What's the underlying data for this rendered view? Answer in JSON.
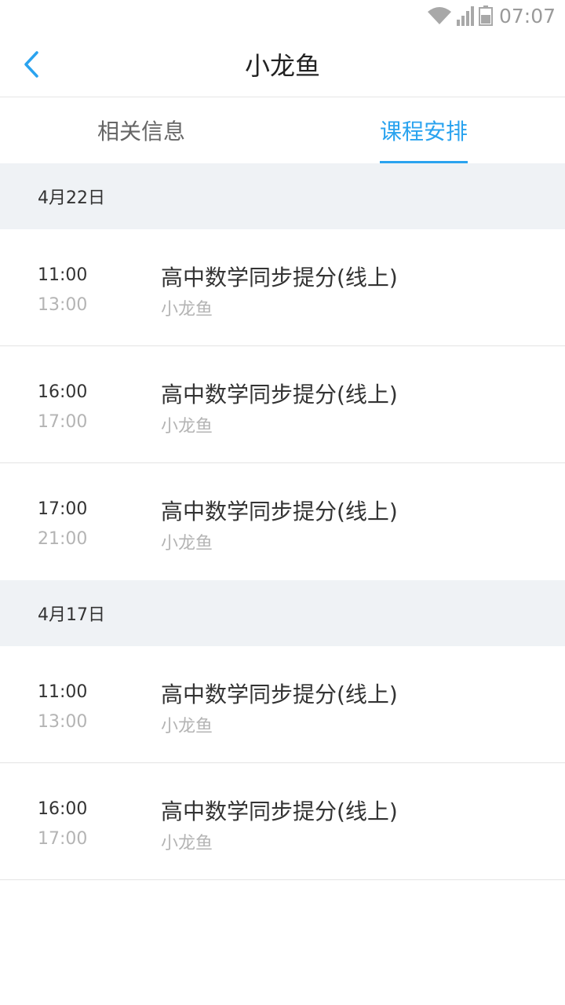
{
  "status_bar": {
    "time": "07:07",
    "icons": [
      "wifi-icon",
      "signal-icon",
      "battery-icon"
    ]
  },
  "header": {
    "title": "小龙鱼",
    "back_icon": "chevron-left-icon"
  },
  "tabs": [
    {
      "label": "相关信息",
      "active": false
    },
    {
      "label": "课程安排",
      "active": true
    }
  ],
  "colors": {
    "accent": "#2aa3ef",
    "section_bg": "#eff2f5",
    "muted_text": "#b4b4b4"
  },
  "schedule": [
    {
      "date": "4月22日",
      "items": [
        {
          "start": "11:00",
          "end": "13:00",
          "title": "高中数学同步提分(线上)",
          "teacher": "小龙鱼"
        },
        {
          "start": "16:00",
          "end": "17:00",
          "title": "高中数学同步提分(线上)",
          "teacher": "小龙鱼"
        },
        {
          "start": "17:00",
          "end": "21:00",
          "title": "高中数学同步提分(线上)",
          "teacher": "小龙鱼"
        }
      ]
    },
    {
      "date": "4月17日",
      "items": [
        {
          "start": "11:00",
          "end": "13:00",
          "title": "高中数学同步提分(线上)",
          "teacher": "小龙鱼"
        },
        {
          "start": "16:00",
          "end": "17:00",
          "title": "高中数学同步提分(线上)",
          "teacher": "小龙鱼"
        }
      ]
    }
  ]
}
